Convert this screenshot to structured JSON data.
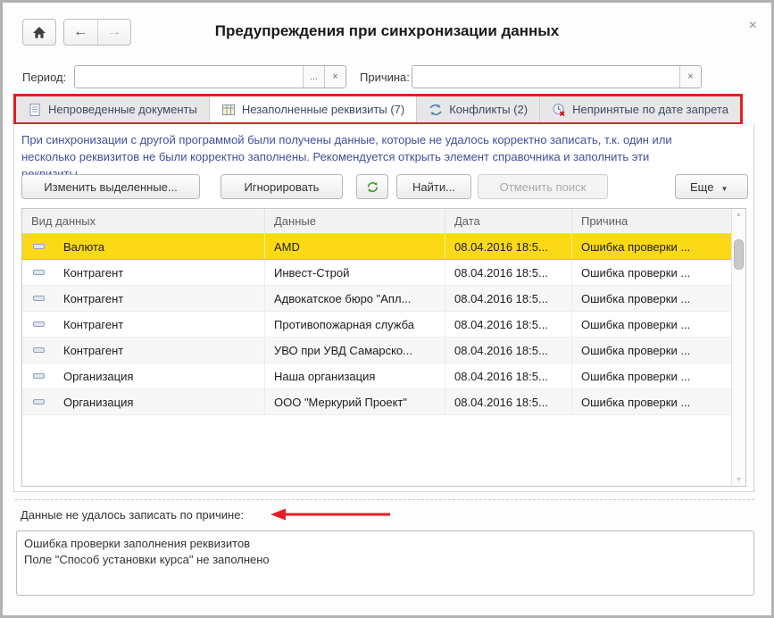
{
  "window": {
    "title": "Предупреждения при синхронизации данных",
    "close_glyph": "×"
  },
  "nav": {
    "back_glyph": "←",
    "forward_glyph": "→"
  },
  "filters": {
    "period_label": "Период:",
    "period_value": "",
    "period_select_glyph": "...",
    "period_clear_glyph": "×",
    "reason_label": "Причина:",
    "reason_value": "",
    "reason_clear_glyph": "×"
  },
  "tabs": {
    "highlight_color": "#e31e24",
    "items": [
      {
        "label": "Непроведенные документы",
        "icon": "document-icon",
        "active": false
      },
      {
        "label": "Незаполненные реквизиты (7)",
        "icon": "table-icon",
        "active": true
      },
      {
        "label": "Конфликты (2)",
        "icon": "conflict-arrows-icon",
        "active": false
      },
      {
        "label": "Непринятые по дате запрета",
        "icon": "clock-denied-icon",
        "active": false
      }
    ]
  },
  "panel": {
    "info_text": "При синхронизации с другой программой были получены данные, которые не удалось корректно записать, т.к. один или несколько реквизитов не были корректно заполнены. Рекомендуется открыть элемент справочника и заполнить эти реквизиты.",
    "buttons": {
      "edit_selected": "Изменить выделенные...",
      "ignore": "Игнорировать",
      "find": "Найти...",
      "cancel_search": "Отменить поиск",
      "cancel_search_enabled": false,
      "more": "Еще",
      "more_caret": "▼"
    }
  },
  "table": {
    "selection_color": "#fbd916",
    "columns": [
      "Вид данных",
      "Данные",
      "Дата",
      "Причина"
    ],
    "rows": [
      {
        "kind": "Валюта",
        "data": "AMD",
        "date": "08.04.2016 18:5...",
        "reason": "Ошибка проверки ...",
        "selected": true
      },
      {
        "kind": "Контрагент",
        "data": "Инвест-Строй",
        "date": "08.04.2016 18:5...",
        "reason": "Ошибка проверки ...",
        "selected": false
      },
      {
        "kind": "Контрагент",
        "data": "Адвокатское бюро \"Апл...",
        "date": "08.04.2016 18:5...",
        "reason": "Ошибка проверки ...",
        "selected": false
      },
      {
        "kind": "Контрагент",
        "data": "Противопожарная служба",
        "date": "08.04.2016 18:5...",
        "reason": "Ошибка проверки ...",
        "selected": false
      },
      {
        "kind": "Контрагент",
        "data": "УВО при УВД Самарско...",
        "date": "08.04.2016 18:5...",
        "reason": "Ошибка проверки ...",
        "selected": false
      },
      {
        "kind": "Организация",
        "data": "Наша организация",
        "date": "08.04.2016 18:5...",
        "reason": "Ошибка проверки ...",
        "selected": false
      },
      {
        "kind": "Организация",
        "data": "ООО \"Меркурий Проект\"",
        "date": "08.04.2016 18:5...",
        "reason": "Ошибка проверки ...",
        "selected": false
      }
    ]
  },
  "footer": {
    "label": "Данные не удалось записать по причине:",
    "details": "Ошибка проверки заполнения реквизитов\nПоле \"Способ установки курса\" не заполнено",
    "arrow_color": "#e31e24"
  }
}
